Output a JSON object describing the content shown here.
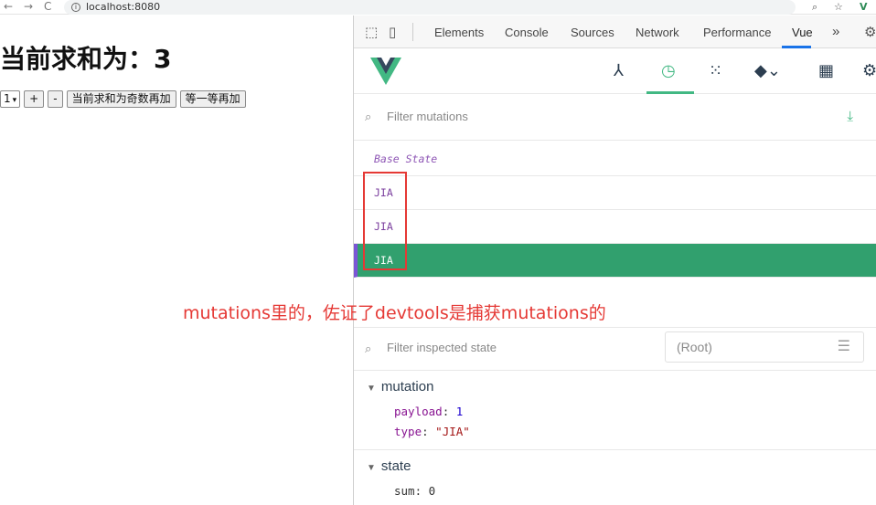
{
  "browser": {
    "back": "←",
    "forward": "→",
    "reload": "C",
    "url": "localhost:8080",
    "zoom_icon": "zoom-icon",
    "star_icon": "star-icon",
    "ext_vue": "V"
  },
  "page": {
    "title": "当前求和为：3",
    "select_value": "1",
    "buttons": {
      "plus": "+",
      "minus": "-",
      "odd": "当前求和为奇数再加",
      "wait": "等一等再加"
    }
  },
  "devtools": {
    "tabs": [
      "Elements",
      "Console",
      "Sources",
      "Network",
      "Performance",
      "Vue"
    ],
    "more": "»",
    "vue": {
      "filter_mutations_placeholder": "Filter mutations",
      "mutations": [
        "Base State",
        "JIA",
        "JIA",
        "JIA"
      ],
      "filter_state_placeholder": "Filter inspected state",
      "root_select": "(Root)",
      "mutation_section": {
        "label": "mutation",
        "payload_key": "payload",
        "payload_value": "1",
        "type_key": "type",
        "type_value": "\"JIA\""
      },
      "state_section": {
        "label": "state",
        "sum_key": "sum",
        "sum_value": "0"
      }
    }
  },
  "annotation": {
    "caption": "mutations里的，佐证了devtools是捕获mutations的"
  },
  "colors": {
    "selected_row": "#31a06e",
    "vue_green": "#42b883",
    "annotation_red": "#e53935"
  }
}
